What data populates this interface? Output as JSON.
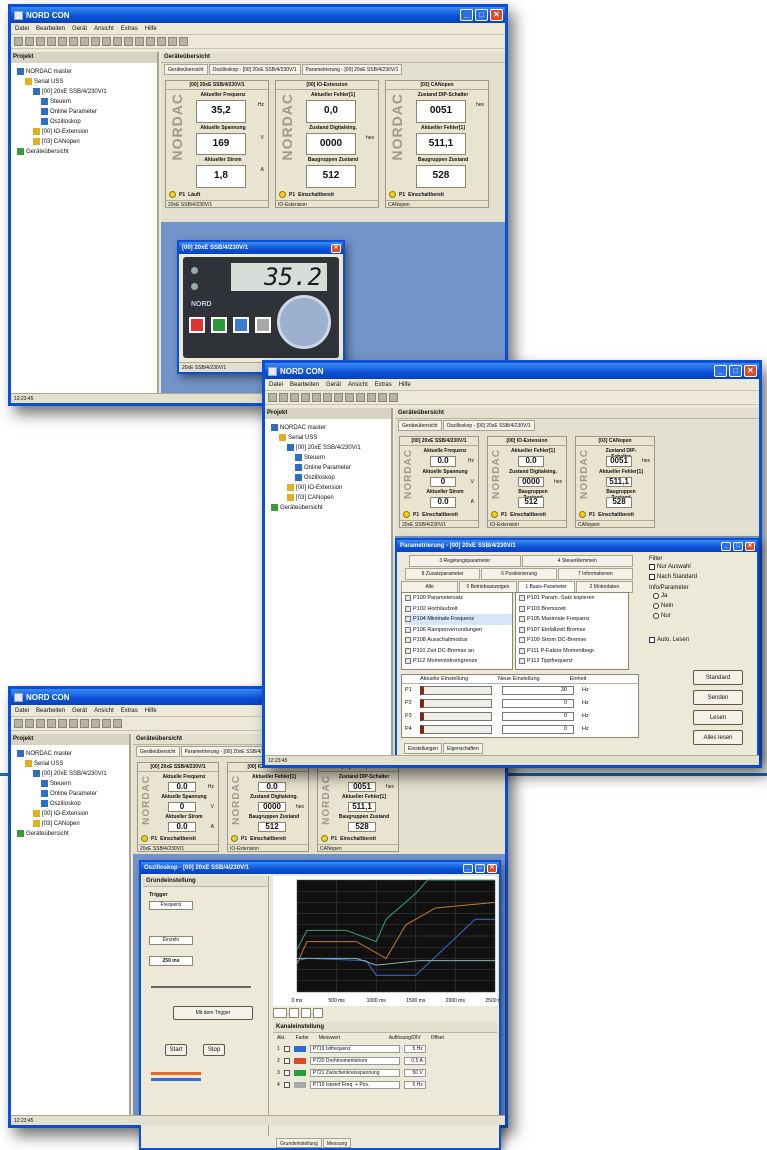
{
  "app": {
    "title": "NORD CON",
    "menu": [
      "Datei",
      "Bearbeiten",
      "Gerät",
      "Ansicht",
      "Extras",
      "Hilfe"
    ],
    "status": "12:23:45"
  },
  "project": {
    "title": "Projekt",
    "tree": [
      "NORDAC master",
      "Serial USS",
      "[00] 20xE SSB/4/230V/1",
      "Steuern",
      "Online Parameter",
      "Oszilloskop",
      "[00] IO-Extension",
      "[03] CANopen",
      "Geräteübersicht"
    ]
  },
  "overview": {
    "title": "Geräteübersicht",
    "tabs": [
      "Geräteübersicht",
      "Oszilloskop - [00] 20xE SSB/4/230V/1",
      "Parametrierung - [00] 20xE SSB/4/230V/1"
    ],
    "brand": "NORDAC"
  },
  "cards": [
    {
      "head": "[00] 20xE SSB/4/230V/1",
      "rows": [
        {
          "label": "Aktueller Frequenz",
          "value": "35,2",
          "unit": "Hz"
        },
        {
          "label": "Aktuelle Spannung",
          "value": "169",
          "unit": "V"
        },
        {
          "label": "Aktueller Strom",
          "value": "1,8",
          "unit": "A"
        }
      ],
      "status_p": "P1",
      "status": "Läuft",
      "foot": "20xE SSB/4/230V/1"
    },
    {
      "head": "[00] IO-Extension",
      "rows": [
        {
          "label": "Aktueller Fehler[1]",
          "value": "0,0",
          "unit": ""
        },
        {
          "label": "Zustand Digitaleing.",
          "value": "0000",
          "unit": "hex"
        },
        {
          "label": "Baugruppen Zustand",
          "value": "512",
          "unit": ""
        }
      ],
      "status_p": "P1",
      "status": "Einschaltbereit",
      "foot": "IO-Extension"
    },
    {
      "head": "[03] CANopen",
      "rows": [
        {
          "label": "Zustand DIP-Schalter",
          "value": "0051",
          "unit": "hex"
        },
        {
          "label": "Aktueller Fehler[1]",
          "value": "511,1",
          "unit": ""
        },
        {
          "label": "Baugruppen Zustand",
          "value": "528",
          "unit": ""
        }
      ],
      "status_p": "P1",
      "status": "Einschaltbereit",
      "foot": "CANopen"
    }
  ],
  "cards2": [
    {
      "head": "[00] 20xE SSB/4/230V/1",
      "rows": [
        {
          "label": "Aktuelle Frequenz",
          "value": "0.0",
          "unit": "Hz"
        },
        {
          "label": "Aktuelle Spannung",
          "value": "0",
          "unit": "V"
        },
        {
          "label": "Aktueller Strom",
          "value": "0.0",
          "unit": "A"
        }
      ],
      "status_p": "P1",
      "status": "Einschaltbereit",
      "foot": "20xE SSB/4/230V/1"
    },
    {
      "head": "[00] IO-Extension",
      "rows": [
        {
          "label": "Aktueller Fehler[1]",
          "value": "0.0",
          "unit": ""
        },
        {
          "label": "Zustand Digitaleing.",
          "value": "0000",
          "unit": "hex"
        },
        {
          "label": "Baugruppen Zustand",
          "value": "512",
          "unit": ""
        }
      ],
      "status_p": "P1",
      "status": "Einschaltbereit",
      "foot": "IO-Extension"
    },
    {
      "head": "[03] CANopen",
      "rows": [
        {
          "label": "Zustand DIP-Schalter",
          "value": "0051",
          "unit": "hex"
        },
        {
          "label": "Aktueller Fehler[1]",
          "value": "511,1",
          "unit": ""
        },
        {
          "label": "Baugruppen Zustand",
          "value": "528",
          "unit": ""
        }
      ],
      "status_p": "P1",
      "status": "Einschaltbereit",
      "foot": "CANopen"
    }
  ],
  "control": {
    "title": "[00] 20xE SSB/4/230V/1",
    "display": "35.2",
    "logo": "NORD",
    "foot": "20xE SSB/4/230V/1"
  },
  "param": {
    "title": "Parametrierung - [00] 20xE SSB/4/230V/1",
    "tabs": [
      [
        "3 Regelungsparameter",
        "4 Steuerklemmen"
      ],
      [
        "8 Zusatzparameter",
        "6 Positionierung",
        "7 Informationen"
      ],
      [
        "Alle",
        "0 Betriebsanzeigen",
        "1 Basis-Parameter",
        "2 Motordaten"
      ]
    ],
    "list_left": [
      "P100 Parametersatz",
      "P102 Hochlaufzeit",
      "P104 Minimale Frequenz",
      "P106 Rampenverrundungen",
      "P108 Ausschaltmodus",
      "P110 Zeit DC-Bremse an",
      "P112 Momentstromgrenze"
    ],
    "list_right": [
      "P101 Param.-Satz kopieren",
      "P103 Bremszeit",
      "P105 Maximale Frequenz",
      "P107 Einfallzeit Bremse",
      "P109 Strom DC-Bremse",
      "P111 P-Faktor Momentbegr.",
      "P113 Tippfrequenz"
    ],
    "filter_title": "Filter",
    "filter": [
      "Nur Auswahl",
      "Nach Standard"
    ],
    "group_title": "Info/Parameter",
    "group": [
      "Ja",
      "Nein",
      "Nur"
    ],
    "auto": "Auto. Lesen",
    "cols": [
      "Aktuelle Einstellung",
      "Neue Einstellung",
      "Einheit"
    ],
    "sets": [
      {
        "p": "P1",
        "new": "30",
        "unit": "Hz"
      },
      {
        "p": "P2",
        "new": "0",
        "unit": "Hz"
      },
      {
        "p": "P3",
        "new": "0",
        "unit": "Hz"
      },
      {
        "p": "P4",
        "new": "0",
        "unit": "Hz"
      }
    ],
    "buttons": [
      "Standard",
      "Senden",
      "Lesen",
      "Alles lesen"
    ],
    "bottom_tabs": [
      "Einstellungen",
      "Eigenschaften"
    ],
    "foot": "20xE SSB/4/230V/1"
  },
  "osc": {
    "title": "Oszilloskop - [00] 20xE SSB/4/230V/1",
    "settings": "Grundeinstellung",
    "trigger": "Trigger",
    "trigger_val": "Frequenz",
    "mode": "Einzeln",
    "time": "250 ms",
    "start": "Start",
    "stop": "Stop",
    "trigger_btn": "Mit dem Trigger",
    "channel_title": "Kanaleinstellung",
    "chan_cols": [
      "Akt.",
      "Farbe",
      "Messwert",
      "Auflösung/DIV",
      "Offset"
    ],
    "channels": [
      {
        "name": "P719 Istfrequenz",
        "res": "5 Hz"
      },
      {
        "name": "P720 Drehmomentstrom",
        "res": "0,5 A"
      },
      {
        "name": "P721 Zwischenkreisspannung",
        "res": "50 V"
      },
      {
        "name": "P719 Istwert Freq. + Pos.",
        "res": "5 Hz"
      }
    ],
    "bottom_tabs": [
      "Grundeinstellung",
      "Messung"
    ],
    "xticks": [
      "0 ms",
      "500 ms",
      "1000 ms",
      "1500 ms",
      "2000 ms",
      "2500 ms"
    ]
  }
}
